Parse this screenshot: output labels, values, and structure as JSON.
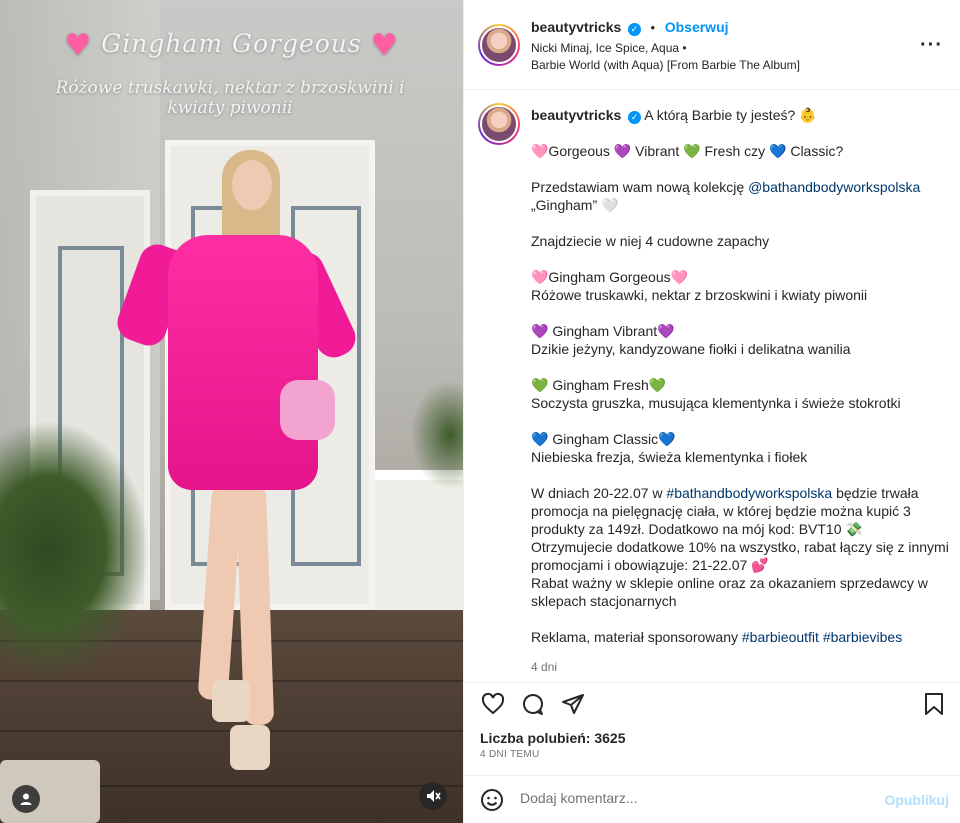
{
  "media": {
    "title": "Gingham Gorgeous",
    "subtitle": "Różowe truskawki, nektar z brzoskwini i kwiaty piwonii"
  },
  "header": {
    "username": "beautyvtricks",
    "follow_label": "Obserwuj",
    "music_line_1": "Nicki Minaj, Ice Spice, Aqua •",
    "music_line_2": "Barbie World (with Aqua) [From Barbie The Album]"
  },
  "caption": {
    "username": "beautyvtricks",
    "intro": "A którą Barbie ty jesteś? 👶",
    "line_options": "🩷Gorgeous 💜 Vibrant 💚 Fresh czy 💙 Classic?",
    "present_a": "Przedstawiam wam nową kolekcję ",
    "present_tag": "@bathandbodyworkspolska",
    "present_b": "„Gingham” 🤍",
    "four_scents": "Znajdziecie w niej 4 cudowne zapachy",
    "gorgeous_title": "🩷Gingham Gorgeous🩷",
    "gorgeous_desc": "Różowe truskawki, nektar z brzoskwini i kwiaty piwonii",
    "vibrant_title": "💜 Gingham Vibrant💜",
    "vibrant_desc": "Dzikie jeżyny, kandyzowane fiołki i delikatna wanilia",
    "fresh_title": "💚 Gingham Fresh💚",
    "fresh_desc": "Soczysta gruszka, musująca klementynka i świeże stokrotki",
    "classic_title": "💙 Gingham Classic💙",
    "classic_desc": "Niebieska frezja, świeża klementynka i fiołek",
    "promo_a": "W dniach 20-22.07 w ",
    "promo_tag": "#bathandbodyworkspolska",
    "promo_b": " będzie trwała promocja na pielęgnację ciała, w której będzie można kupić 3 produkty za 149zł. Dodatkowo na mój kod: BVT10 💸",
    "promo_c": "Otrzymujecie dodatkowe 10% na wszystko, rabat łączy się z innymi promocjami i obowiązuje: 21-22.07 💕",
    "promo_d": "Rabat ważny w sklepie online oraz za okazaniem sprzedawcy w sklepach stacjonarnych",
    "ad_a": "Reklama, materiał sponsorowany ",
    "ad_tag1": "#barbieoutfit",
    "ad_tag2": "#barbievibes",
    "time": "4 dni"
  },
  "actions": {
    "likes": "Liczba polubień: 3625",
    "posted": "4 DNI TEMU"
  },
  "comment": {
    "placeholder": "Dodaj komentarz...",
    "publish_label": "Opublikuj"
  },
  "colors": {
    "accent": "#0095f6",
    "link": "#00376b",
    "dress": "#f11b98"
  }
}
